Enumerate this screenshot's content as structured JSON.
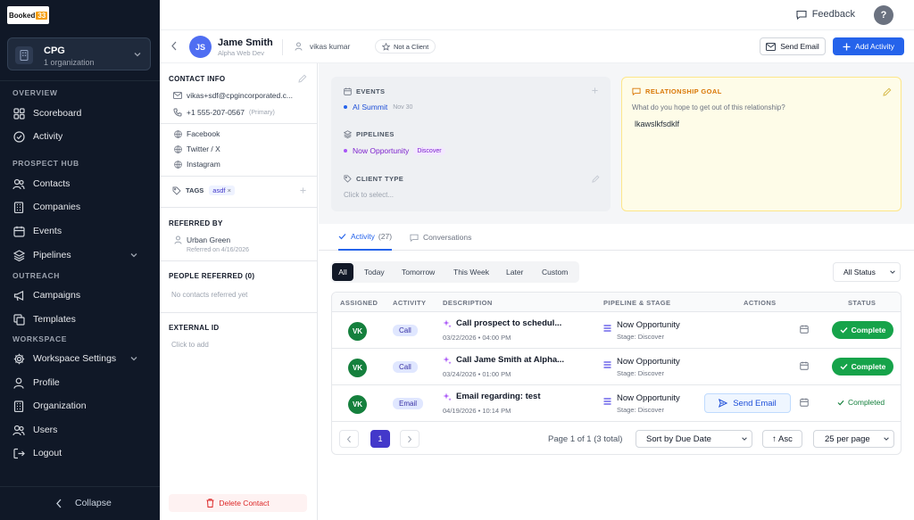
{
  "sidebar": {
    "logo_text": "Booked",
    "logo_number": "33",
    "org": {
      "name": "CPG",
      "sub": "1 organization"
    },
    "sections": {
      "overview": "OVERVIEW",
      "prospect_hub": "PROSPECT HUB",
      "outreach": "OUTREACH",
      "workspace": "WORKSPACE"
    },
    "items": {
      "scoreboard": "Scoreboard",
      "activity": "Activity",
      "contacts": "Contacts",
      "companies": "Companies",
      "events": "Events",
      "pipelines": "Pipelines",
      "campaigns": "Campaigns",
      "templates": "Templates",
      "workspace_settings": "Workspace Settings",
      "profile": "Profile",
      "organization": "Organization",
      "users": "Users",
      "logout": "Logout"
    },
    "collapse": "Collapse"
  },
  "topbar": {
    "feedback": "Feedback",
    "help": "?"
  },
  "contact": {
    "initials": "JS",
    "name": "Jame Smith",
    "subtitle": "Alpha Web Dev",
    "owner": "vikas kumar",
    "client_status": "Not a Client",
    "send_email": "Send Email",
    "add_activity": "Add Activity"
  },
  "left_panel": {
    "contact_info_title": "CONTACT INFO",
    "email": "vikas+sdf@cpgincorporated.c...",
    "phone": "+1 555-207-0567",
    "phone_tag": "(Primary)",
    "social": {
      "facebook": "Facebook",
      "twitter": "Twitter / X",
      "instagram": "Instagram"
    },
    "tags_label": "TAGS",
    "tag": "asdf",
    "referred_by_title": "REFERRED BY",
    "referrer": "Urban Green",
    "referred_on": "Referred on 4/16/2026",
    "people_referred_title": "PEOPLE REFERRED (0)",
    "no_referrals": "No contacts referred yet",
    "external_id_title": "EXTERNAL ID",
    "click_to_add": "Click to add",
    "delete": "Delete Contact"
  },
  "info_card": {
    "events_title": "EVENTS",
    "event_name": "AI Summit",
    "event_date": "Nov 30",
    "pipelines_title": "PIPELINES",
    "pipeline_name": "Now Opportunity",
    "pipeline_stage": "Discover",
    "client_type_title": "CLIENT TYPE",
    "client_type_placeholder": "Click to select..."
  },
  "goal_card": {
    "title": "RELATIONSHIP GOAL",
    "question": "What do you hope to get out of this relationship?",
    "answer": "lkawslkfsdklf"
  },
  "tabs": {
    "activity": "Activity",
    "activity_count": "(27)",
    "conversations": "Conversations"
  },
  "filters": {
    "all": "All",
    "today": "Today",
    "tomorrow": "Tomorrow",
    "this_week": "This Week",
    "later": "Later",
    "custom": "Custom",
    "status": "All Status"
  },
  "table": {
    "headers": {
      "assigned": "ASSIGNED",
      "activity": "ACTIVITY",
      "description": "DESCRIPTION",
      "pipeline": "PIPELINE & STAGE",
      "actions": "ACTIONS",
      "status": "STATUS"
    },
    "rows": [
      {
        "initials": "VK",
        "type": "Call",
        "title": "Call prospect to schedul...",
        "when": "03/22/2026 • 04:00 PM",
        "pipeline": "Now Opportunity",
        "stage": "Stage: Discover",
        "status": "Complete"
      },
      {
        "initials": "VK",
        "type": "Call",
        "title": "Call Jame Smith at Alpha...",
        "when": "03/24/2026 • 01:00 PM",
        "pipeline": "Now Opportunity",
        "stage": "Stage: Discover",
        "status": "Complete"
      },
      {
        "initials": "VK",
        "type": "Email",
        "title": "Email regarding: test",
        "when": "04/19/2026 • 10:14 PM",
        "pipeline": "Now Opportunity",
        "stage": "Stage: Discover",
        "action": "Send Email",
        "status": "Completed"
      }
    ],
    "pager": {
      "page": "1",
      "info": "Page 1 of 1 (3 total)",
      "sort": "Sort by Due Date",
      "order": "↑ Asc",
      "per_page": "25 per page"
    }
  },
  "colors": {
    "sidebar_bg": "#101827",
    "primary": "#2563eb",
    "success": "#16a34a",
    "goal_bg": "#fefce8",
    "danger": "#dc2626"
  }
}
